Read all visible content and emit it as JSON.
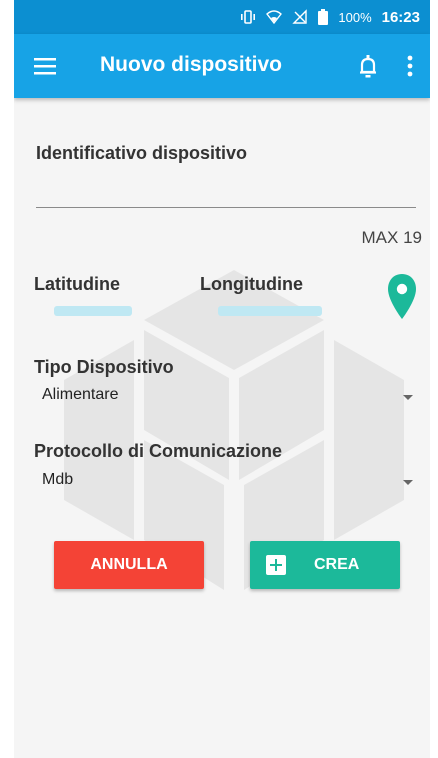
{
  "status_bar": {
    "battery_percent": "100%",
    "time": "16:23"
  },
  "app_bar": {
    "title": "Nuovo dispositivo"
  },
  "form": {
    "device_id_label": "Identificativo dispositivo",
    "max_hint": "MAX 19",
    "latitude_label": "Latitudine",
    "longitude_label": "Longitudine",
    "device_type_label": "Tipo Dispositivo",
    "device_type_value": "Alimentare",
    "protocol_label": "Protocollo di Comunicazione",
    "protocol_value": "Mdb"
  },
  "buttons": {
    "cancel_label": "ANNULLA",
    "create_label": "CREA"
  },
  "colors": {
    "status_bar": "#0c8fd1",
    "app_bar": "#17a3e6",
    "cancel": "#f44336",
    "create": "#1cb99a",
    "pin": "#1cb99a"
  },
  "icons": [
    "vibrate-icon",
    "wifi-icon",
    "signal-icon",
    "battery-icon",
    "menu-icon",
    "bell-icon",
    "more-vert-icon",
    "location-pin-icon",
    "add-box-icon"
  ]
}
